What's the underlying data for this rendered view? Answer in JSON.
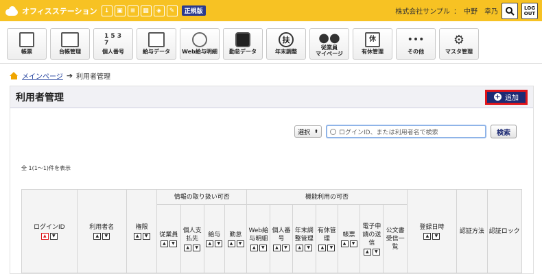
{
  "header": {
    "app_name": "オフィスステーション",
    "top_icons": [
      "download-icon",
      "suitcase-icon",
      "document-icon",
      "building-icon",
      "cube-icon",
      "pencil-icon"
    ],
    "edition": "正規版",
    "company": "株式会社サンプル",
    "separator": "：",
    "user": "中野　幸乃",
    "logout_line1": "LOG",
    "logout_line2": "OUT"
  },
  "menu": [
    {
      "label": "帳票",
      "icon": "document-list-icon"
    },
    {
      "label": "台帳管理",
      "icon": "ledger-icon"
    },
    {
      "label": "個人番号",
      "icon": "personal-number-icon",
      "glyph": "1 5 3 7"
    },
    {
      "label": "給与データ",
      "icon": "salary-data-icon"
    },
    {
      "label": "Web給与明細",
      "icon": "web-payslip-icon"
    },
    {
      "label": "勤怠データ",
      "icon": "attendance-clock-icon"
    },
    {
      "label": "年末調整",
      "icon": "year-end-icon",
      "glyph": "扶"
    },
    {
      "label": "従業員\nマイページ",
      "icon": "employee-mypage-icon"
    },
    {
      "label": "有休管理",
      "icon": "paid-leave-icon",
      "glyph": "休"
    },
    {
      "label": "その他",
      "icon": "more-dots-icon"
    },
    {
      "label": "マスタ管理",
      "icon": "gears-icon"
    }
  ],
  "breadcrumb": {
    "home": "メインページ",
    "arrow": "➔",
    "current": "利用者管理"
  },
  "panel": {
    "title": "利用者管理",
    "add_label": "追加"
  },
  "search": {
    "select_value": "選択",
    "placeholder": "ログインID、または利用者名で検索",
    "button": "検索"
  },
  "count_text": "全 1(1〜1)件を表示",
  "table": {
    "login_id": "ログインID",
    "user_name": "利用者名",
    "permission": "権限",
    "group_info": "情報の取り扱い可否",
    "group_func": "機能利用の可否",
    "info_cols": [
      "従業員",
      "個人支払先",
      "給与",
      "勤怠"
    ],
    "func_cols": [
      "Web給与明細",
      "個人番号",
      "年末調整管理",
      "有休管理",
      "帳票",
      "電子申請の送信",
      "公文書受信一覧"
    ],
    "registered_at": "登録日時",
    "auth_method": "認証方法",
    "auth_lock": "認証ロック"
  }
}
